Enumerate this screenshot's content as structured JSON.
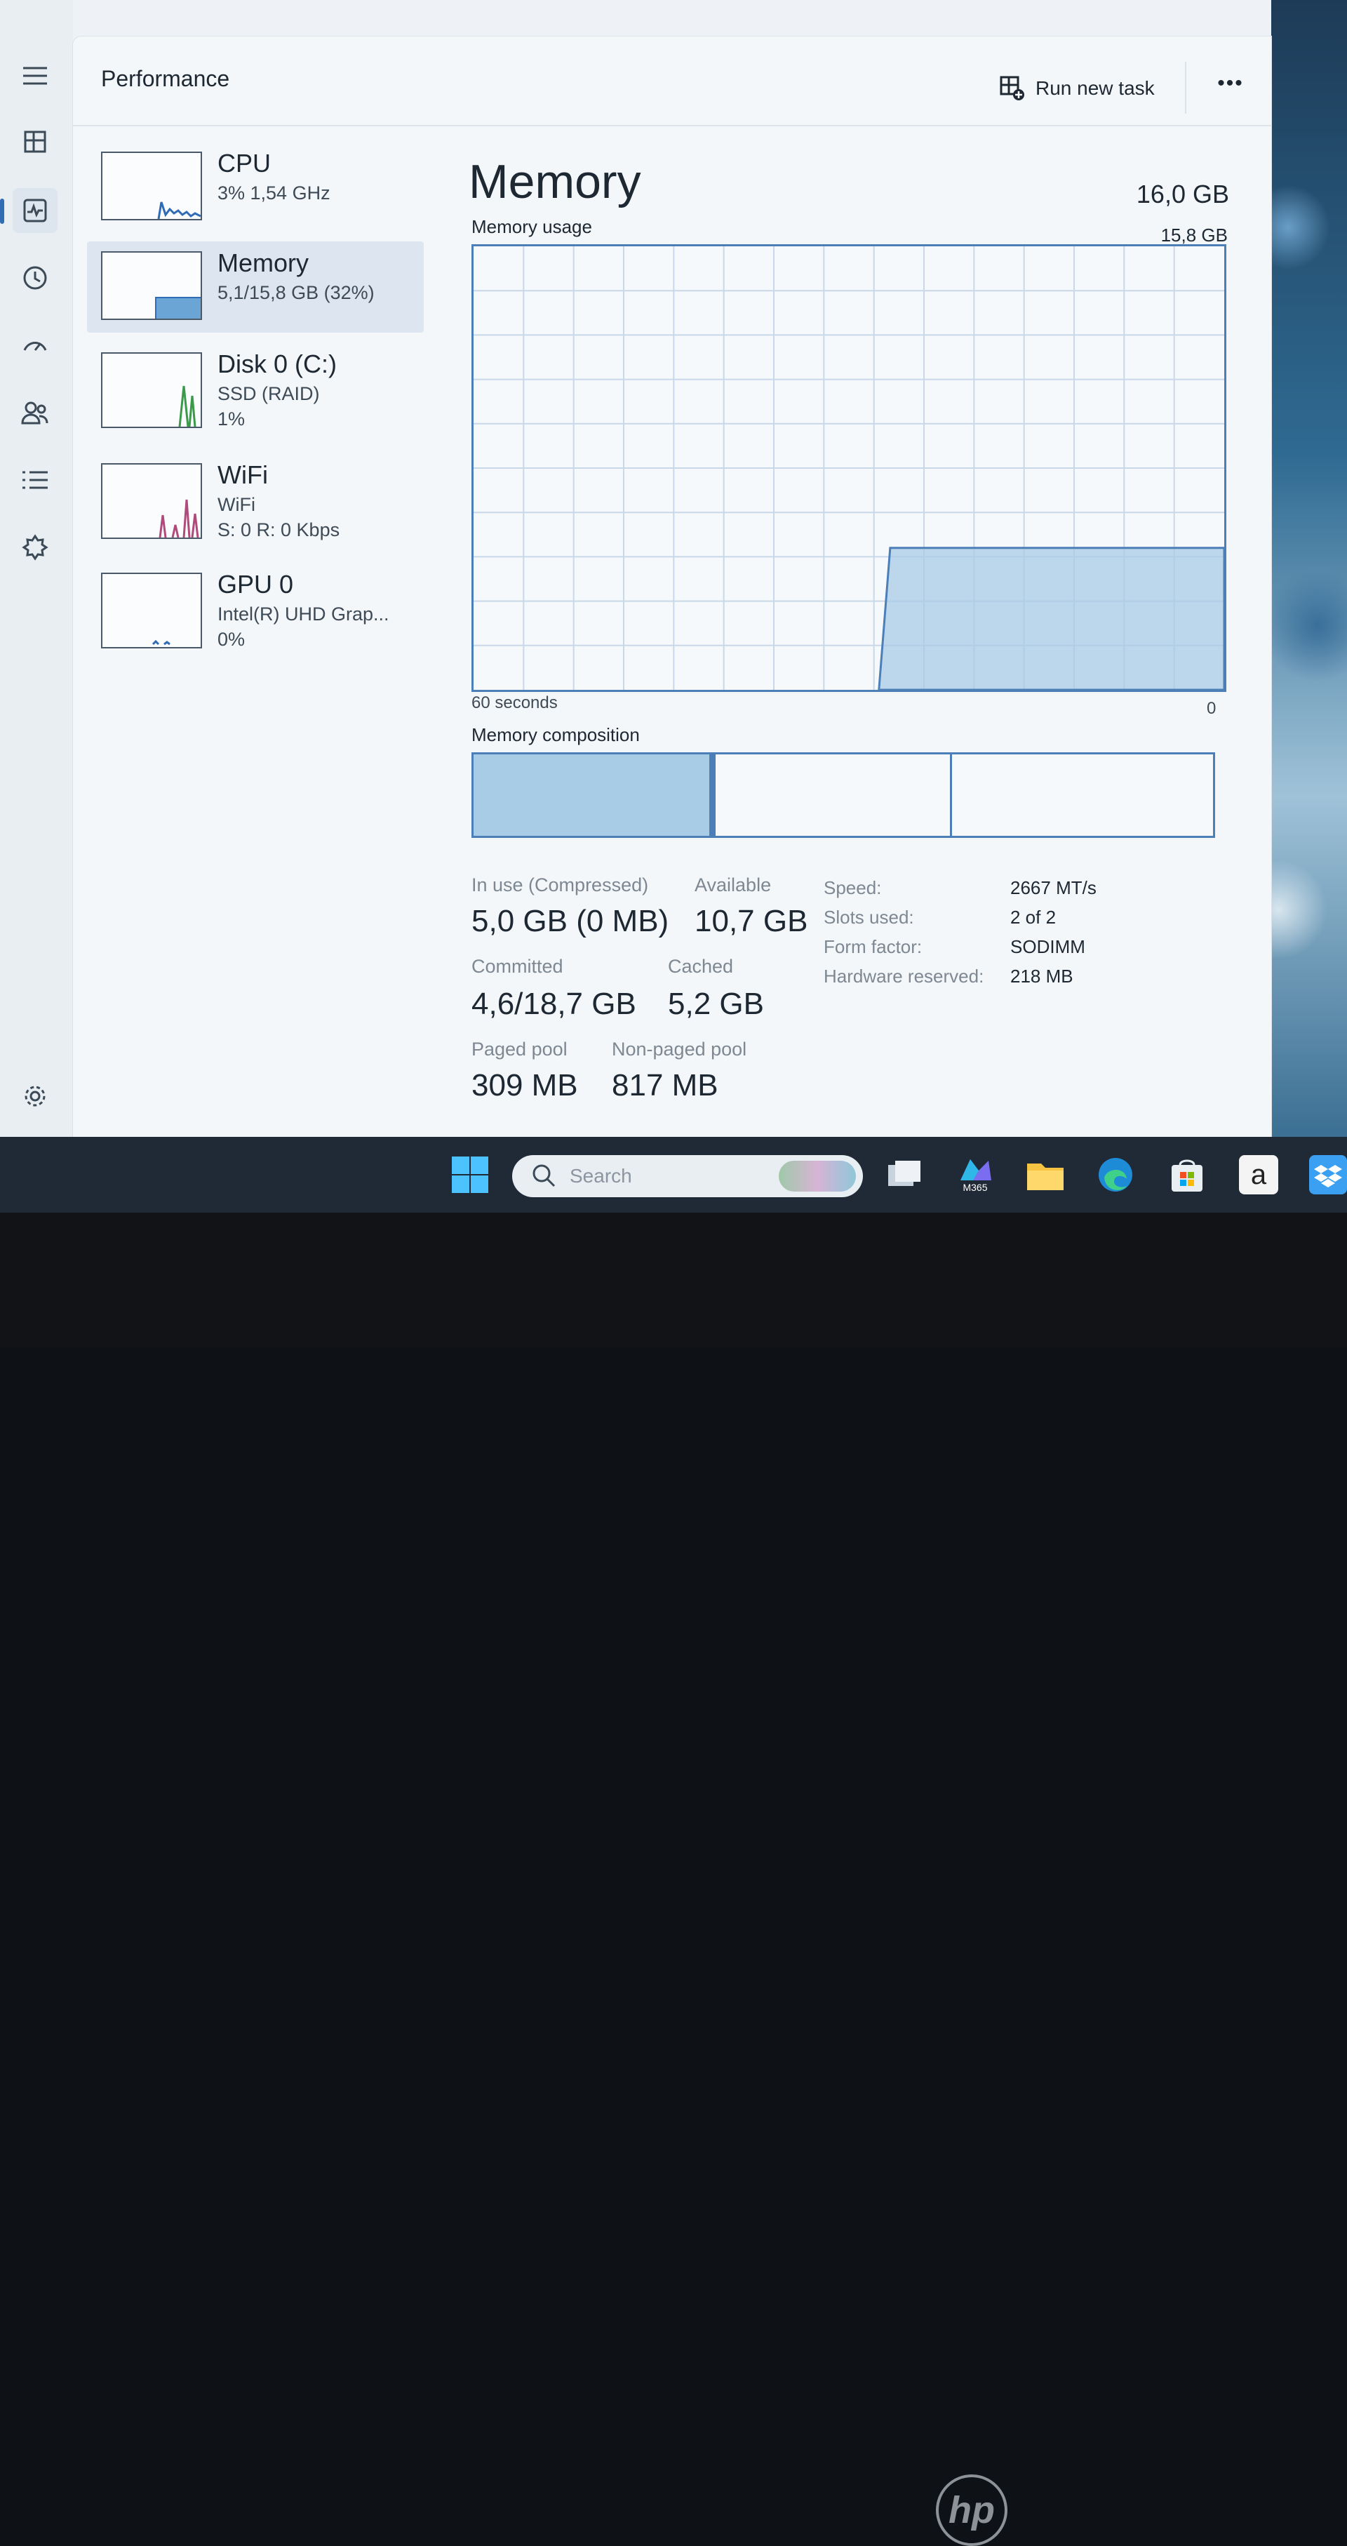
{
  "app": {
    "page_title": "Performance",
    "run_task_label": "Run new task",
    "more_label": "•••"
  },
  "colors": {
    "accent": "#2f6cb5",
    "graph_fill": "#a8cbe6",
    "graph_line": "#4c7fb8"
  },
  "nav": [
    "menu-icon",
    "processes-icon",
    "performance-icon",
    "app-history-icon",
    "startup-apps-icon",
    "users-icon",
    "details-icon",
    "services-icon",
    "settings-icon"
  ],
  "resources": [
    {
      "name": "CPU",
      "sub1": "3% 1,54 GHz",
      "sub2": ""
    },
    {
      "name": "Memory",
      "sub1": "5,1/15,8 GB (32%)",
      "sub2": ""
    },
    {
      "name": "Disk 0 (C:)",
      "sub1": "SSD (RAID)",
      "sub2": "1%"
    },
    {
      "name": "WiFi",
      "sub1": "WiFi",
      "sub2": "S: 0 R: 0 Kbps"
    },
    {
      "name": "GPU 0",
      "sub1": "Intel(R) UHD Grap...",
      "sub2": "0%"
    }
  ],
  "detail": {
    "title": "Memory",
    "total": "16,0 GB",
    "usage_label": "Memory usage",
    "usage_max": "15,8 GB",
    "axis_left": "60 seconds",
    "axis_right": "0",
    "composition_label": "Memory composition",
    "usage_fraction": 0.32,
    "stats": {
      "in_use_label": "In use (Compressed)",
      "in_use_value": "5,0 GB (0 MB)",
      "available_label": "Available",
      "available_value": "10,7 GB",
      "committed_label": "Committed",
      "committed_value": "4,6/18,7 GB",
      "cached_label": "Cached",
      "cached_value": "5,2 GB",
      "paged_label": "Paged pool",
      "paged_value": "309 MB",
      "nonpaged_label": "Non-paged pool",
      "nonpaged_value": "817 MB"
    },
    "specs": {
      "speed_label": "Speed:",
      "speed_value": "2667 MT/s",
      "slots_label": "Slots used:",
      "slots_value": "2 of 2",
      "form_label": "Form factor:",
      "form_value": "SODIMM",
      "hw_label": "Hardware reserved:",
      "hw_value": "218 MB"
    }
  },
  "taskbar": {
    "search_placeholder": "Search",
    "m365_label": "M365",
    "amazon_label": "a"
  },
  "brand": {
    "laptop_logo": "hp"
  }
}
